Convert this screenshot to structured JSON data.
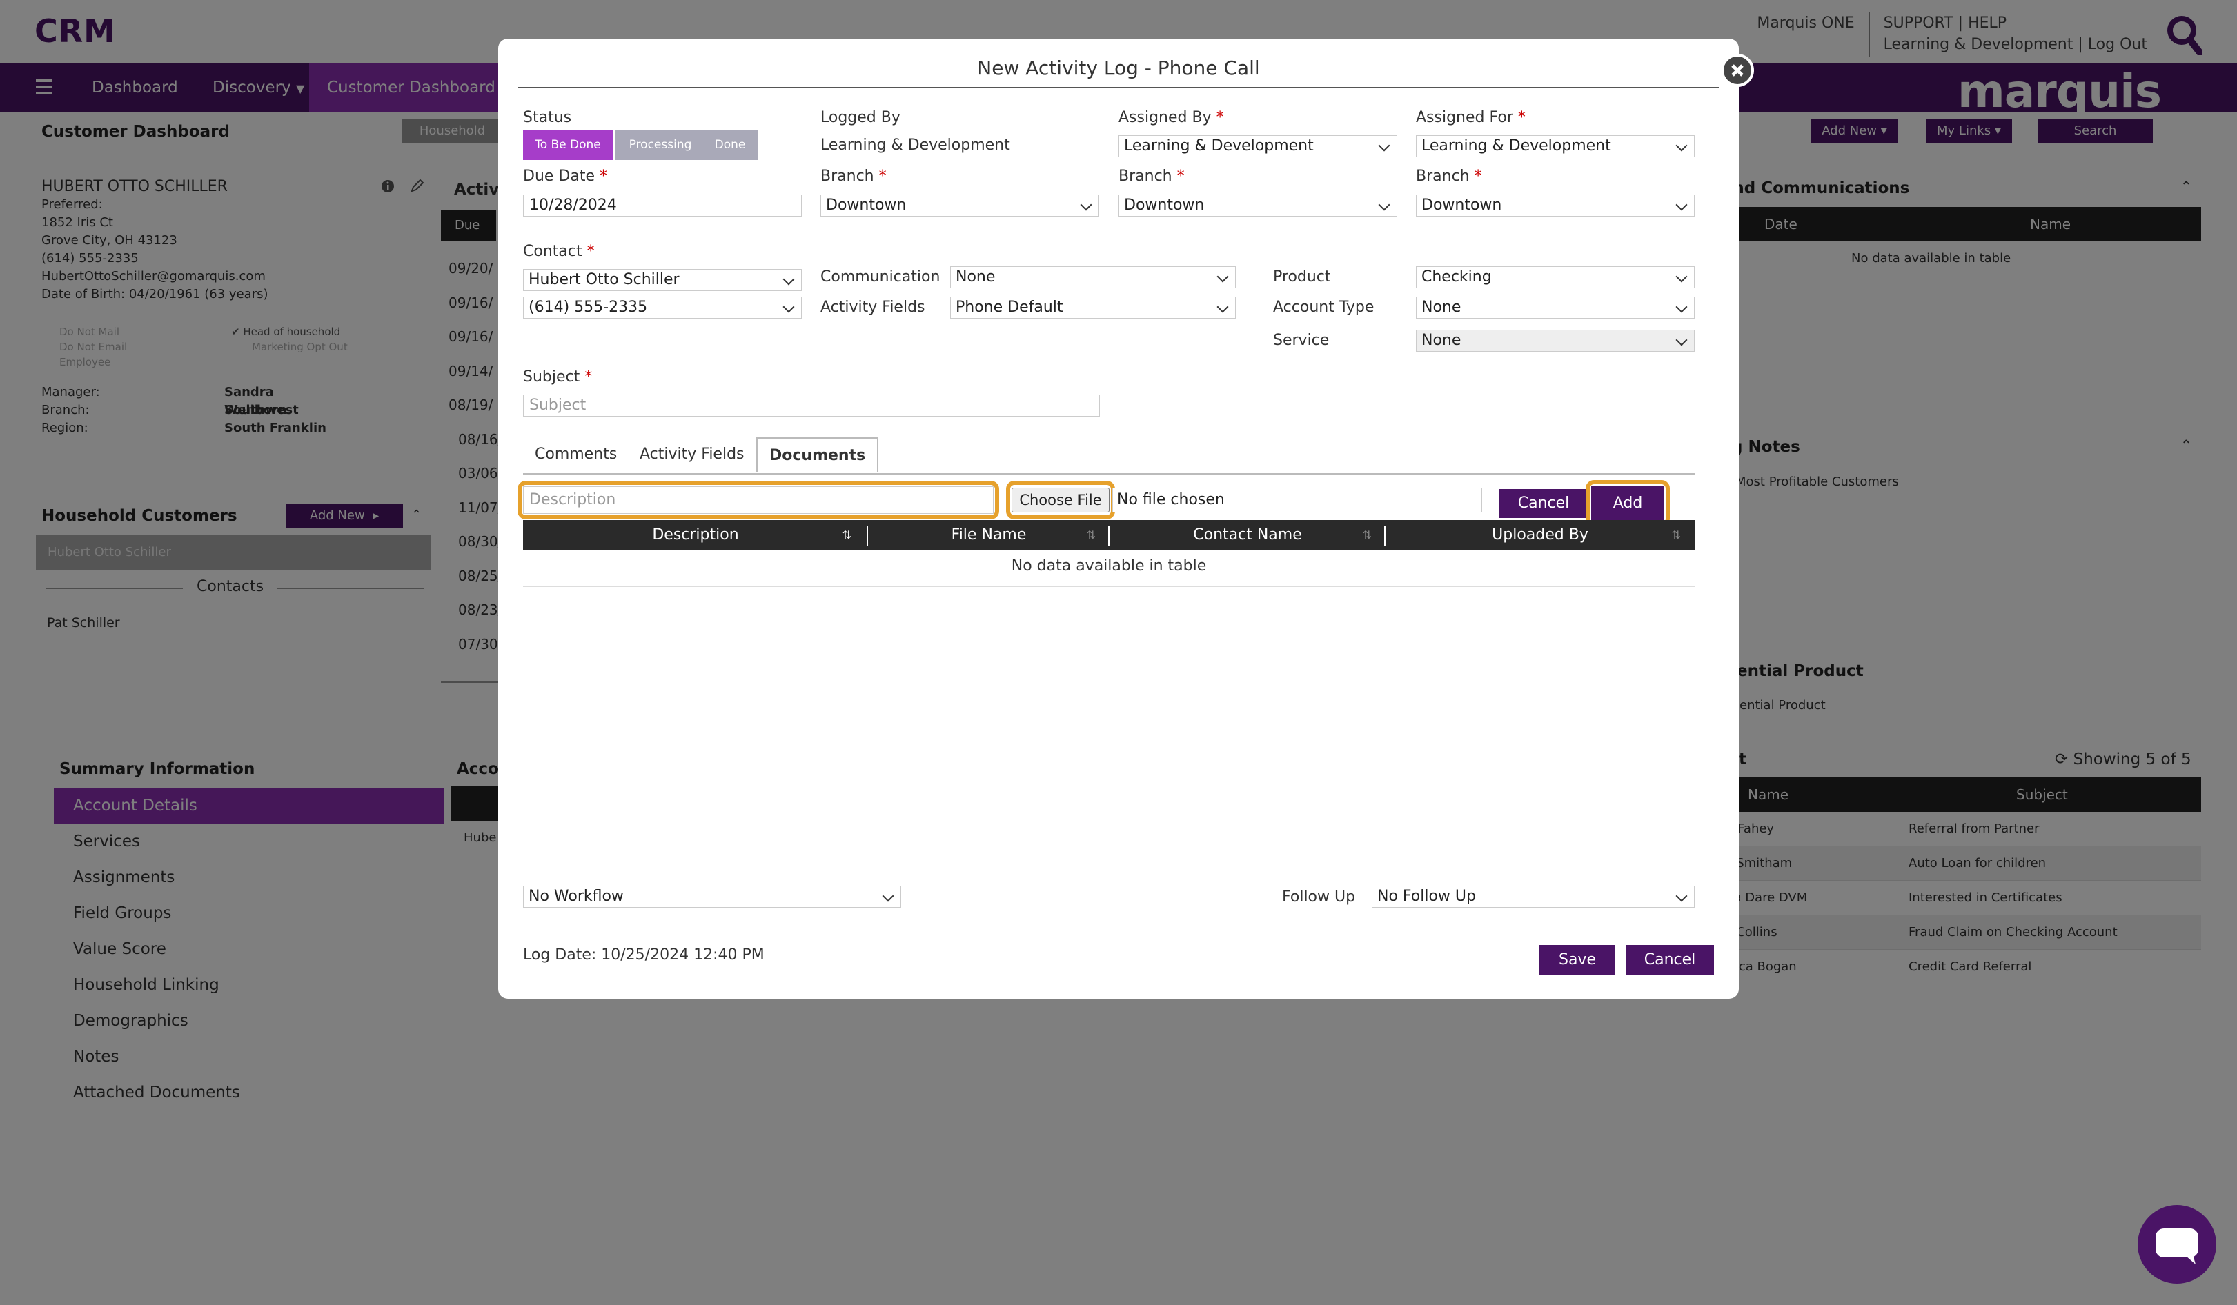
{
  "app": {
    "brand": "CRM",
    "user_name": "Marquis ONE",
    "user_org": "Learning & Development",
    "support": "SUPPORT",
    "help": "HELP",
    "log_out": "Log Out",
    "pipe": "|",
    "logo": "marquis",
    "accent": "#4a1466",
    "highlight": "#e6a12c"
  },
  "nav": {
    "menu_icon": "hamburger-icon",
    "items": [
      "Dashboard",
      "Discovery",
      "Customer Dashboard"
    ]
  },
  "page": {
    "title": "Customer Dashboard",
    "household_tab": "Household",
    "add_new": "Add New",
    "my_links": "My Links",
    "search": "Search"
  },
  "customer": {
    "name": "HUBERT OTTO SCHILLER",
    "preferred": "Preferred:",
    "street": "1852 Iris Ct",
    "city": "Grove City, OH 43123",
    "phone": "(614) 555-2335",
    "email": "HubertOttoSchiller@gomarquis.com",
    "dob": "Date of Birth: 04/20/1961 (63 years)",
    "flags_left": [
      "Do Not Mail",
      "Do Not Email",
      "Employee"
    ],
    "head_of_household": "Head of household",
    "marketing_opt_out": "Marketing Opt Out",
    "manager_label": "Manager:",
    "manager": "Sandra Wellborn",
    "branch_label": "Branch:",
    "branch": "Southwest",
    "region_label": "Region:",
    "region": "South Franklin"
  },
  "household": {
    "title": "Household Customers",
    "add_new": "Add New",
    "selected": "Hubert Otto Schiller",
    "contacts_label": "Contacts",
    "contact": "Pat Schiller"
  },
  "summary": {
    "title": "Summary Information",
    "items": [
      "Account Details",
      "Services",
      "Assignments",
      "Field Groups",
      "Value Score",
      "Household Linking",
      "Demographics",
      "Notes",
      "Attached Documents"
    ]
  },
  "middle": {
    "title": "Activi",
    "header": "Due Da",
    "dates": [
      "09/20/",
      "09/16/",
      "09/16/",
      "09/14/",
      "08/19/",
      "08/16/",
      "03/06/",
      "11/07/",
      "08/30/",
      "08/25/",
      "08/23/",
      "07/30/"
    ],
    "account_title": "Acco",
    "account_row": "Hube"
  },
  "right": {
    "communications_title": "und Communications",
    "comm_headers": [
      "Date",
      "Name"
    ],
    "empty": "No data available in table",
    "notes_title": "g Notes",
    "notes_item": "Most Profitable Customers",
    "potential_title": "ential Product",
    "potential_item": "ential Product",
    "referral_title": "t",
    "showing": "Showing 5 of 5",
    "ref_headers": [
      "Name",
      "Subject"
    ],
    "ref_rows": [
      {
        "name": "bel Fahey",
        "subject": "Referral from Partner"
      },
      {
        "name": "rto Smitham",
        "subject": "Auto Loan for children"
      },
      {
        "name": "iana Dare DVM",
        "subject": "Interested in Certificates"
      },
      {
        "name": "art Collins",
        "subject": "Fraud Claim on Checking Account"
      },
      {
        "name": "essica Bogan",
        "subject": "Credit Card Referral"
      }
    ]
  },
  "modal": {
    "title": "New Activity Log - Phone Call",
    "close_icon": "close-icon",
    "required": "*",
    "status_label": "Status",
    "status_options": [
      "To Be Done",
      "Processing",
      "Done"
    ],
    "status_active_color": "#a63dc9",
    "logged_by_label": "Logged By",
    "logged_by": "Learning & Development",
    "assigned_by_label": "Assigned By",
    "assigned_by": "Learning & Development",
    "assigned_for_label": "Assigned For",
    "assigned_for": "Learning & Development",
    "due_date_label": "Due Date",
    "due_date": "10/28/2024",
    "branch_label": "Branch",
    "branch_logged": "Downtown",
    "branch_assigned_by": "Downtown",
    "branch_assigned_for": "Downtown",
    "contact_label": "Contact",
    "contact": "Hubert Otto Schiller",
    "contact_phone": "(614) 555-2335",
    "communication_label": "Communication",
    "communication": "None",
    "activity_fields_label": "Activity Fields",
    "activity_fields": "Phone Default",
    "product_label": "Product",
    "product": "Checking",
    "account_type_label": "Account Type",
    "account_type": "None",
    "service_label": "Service",
    "service": "None",
    "subject_label": "Subject",
    "subject_placeholder": "Subject",
    "tabs": [
      "Comments",
      "Activity Fields",
      "Documents"
    ],
    "description_placeholder": "Description",
    "choose_file": "Choose File",
    "no_file": "No file chosen",
    "cancel": "Cancel",
    "add": "Add",
    "table_headers": [
      "Description",
      "File Name",
      "Contact Name",
      "Uploaded By"
    ],
    "table_empty": "No data available in table",
    "workflow": "No Workflow",
    "follow_up_label": "Follow Up",
    "follow_up": "No Follow Up",
    "log_date": "Log Date: 10/25/2024 12:40 PM",
    "save": "Save",
    "cancel_footer": "Cancel"
  }
}
